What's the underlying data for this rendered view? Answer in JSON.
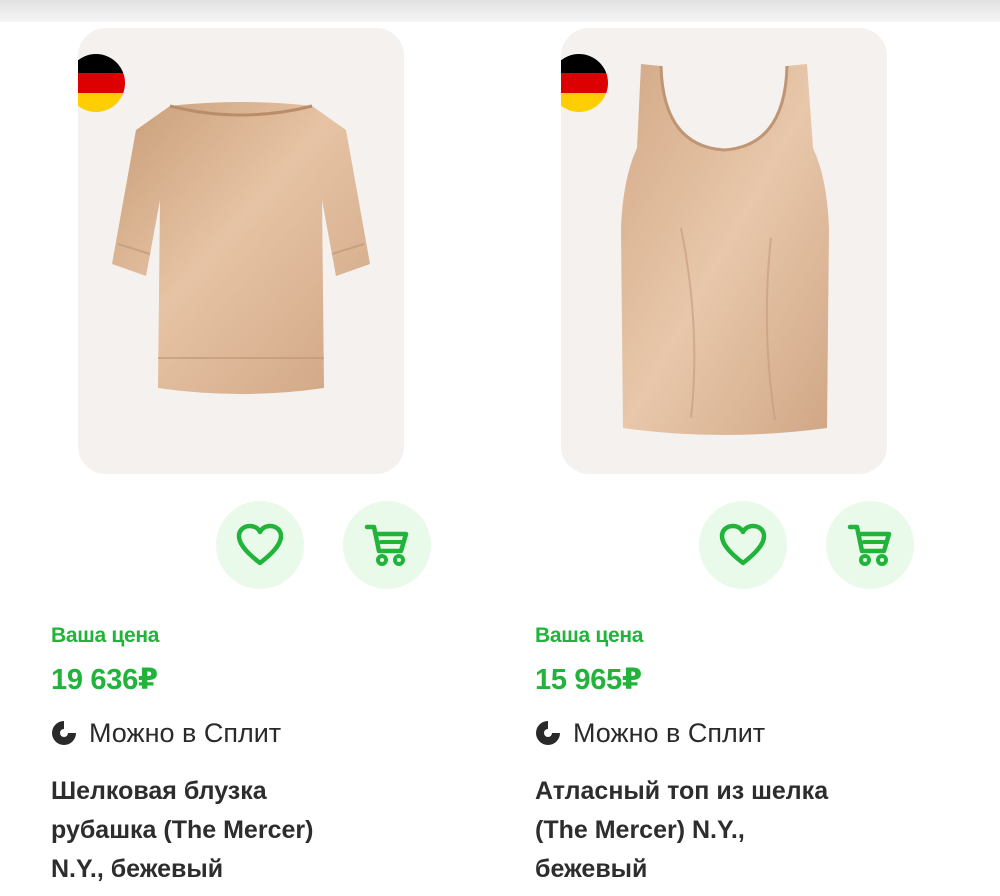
{
  "products": [
    {
      "origin_flag": "germany-flag",
      "image": "satin-blouse-short-sleeve-beige",
      "price_label": "Ваша цена",
      "price": "19 636₽",
      "split_text": "Можно в Сплит",
      "title_lines": [
        "Шелковая блузка",
        "рубашка (The Mercer)",
        "N.Y., бежевый"
      ]
    },
    {
      "origin_flag": "germany-flag",
      "image": "satin-tank-top-beige",
      "price_label": "Ваша цена",
      "price": "15 965₽",
      "split_text": "Можно в Сплит",
      "title_lines": [
        "Атласный топ из шелка",
        "(The Mercer) N.Y.,",
        "бежевый"
      ]
    }
  ],
  "icons": {
    "favorite": "heart-icon",
    "cart": "cart-icon",
    "split": "split-logo-icon"
  },
  "colors": {
    "accent_green": "#21b33a",
    "button_bg": "#eafaea",
    "card_bg": "#f4f1ee",
    "text_dark": "#2d2d2d",
    "garment": "#d9b190"
  }
}
